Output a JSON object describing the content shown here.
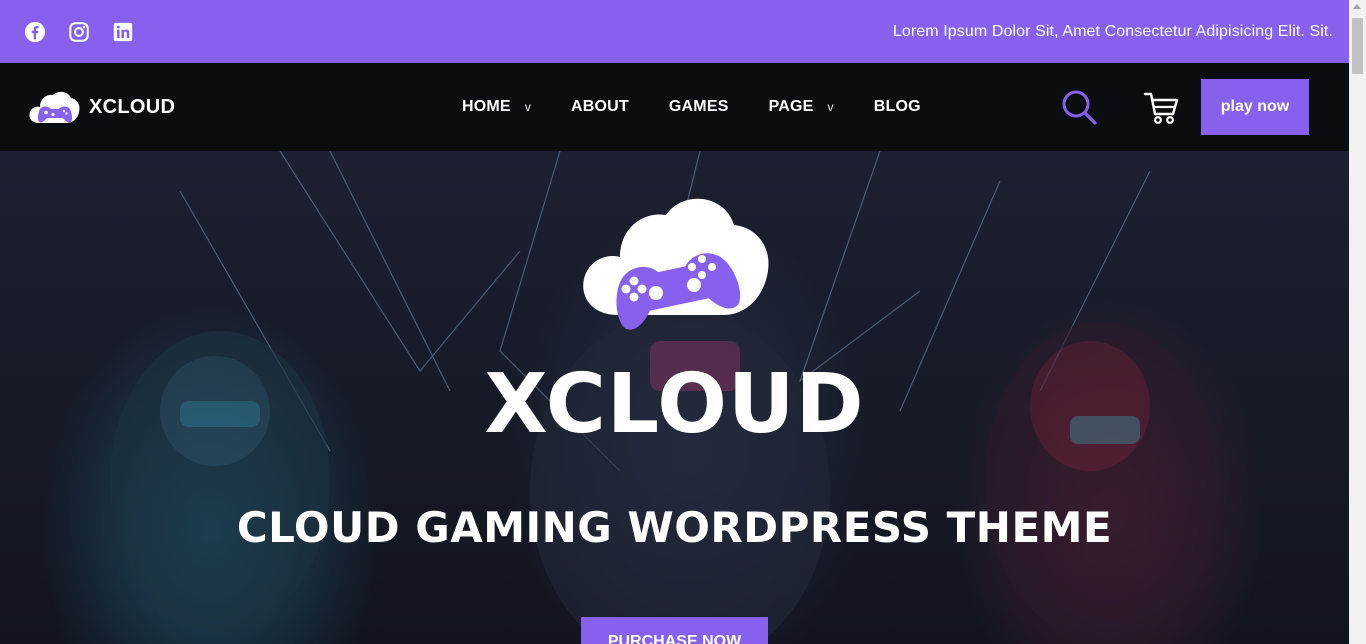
{
  "topbar": {
    "socials": [
      "facebook-icon",
      "instagram-icon",
      "linkedin-icon"
    ],
    "tagline": "Lorem Ipsum Dolor Sit, Amet Consectetur Adipisicing Elit. Sit."
  },
  "navbar": {
    "brand": "XCLOUD",
    "menu": [
      {
        "label": "HOME",
        "caret": "v"
      },
      {
        "label": "ABOUT",
        "caret": ""
      },
      {
        "label": "GAMES",
        "caret": ""
      },
      {
        "label": "PAGE",
        "caret": "v"
      },
      {
        "label": "BLOG",
        "caret": ""
      }
    ],
    "search_icon": "search-icon",
    "cart_icon": "cart-icon",
    "play_button": "play now"
  },
  "hero": {
    "title": "XCLOUD",
    "subtitle": "CLOUD GAMING WORDPRESS THEME",
    "cta": "PURCHASE NOW"
  },
  "colors": {
    "accent": "#8761ee",
    "nav_bg": "#0b0d11"
  }
}
